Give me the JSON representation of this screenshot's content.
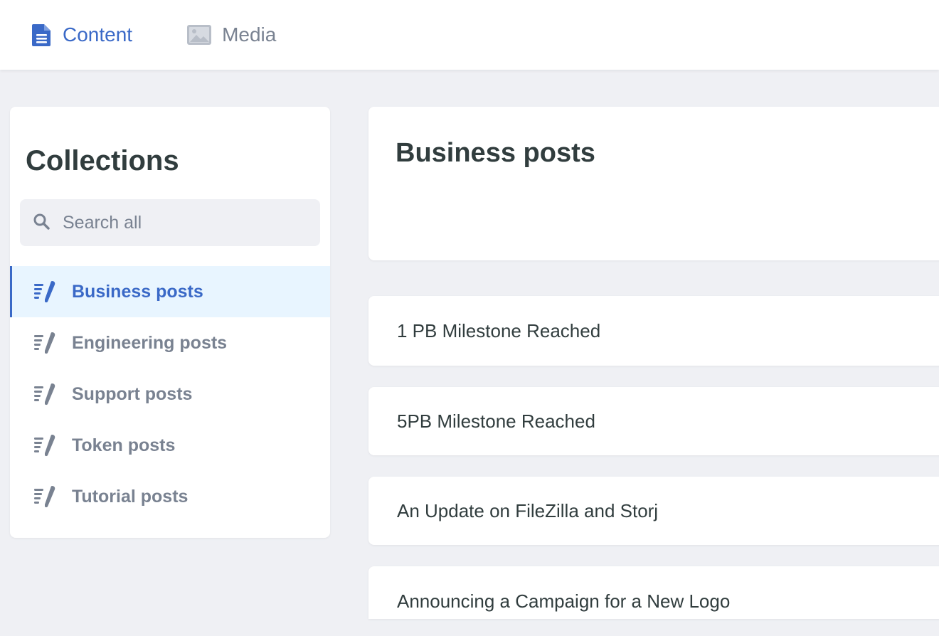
{
  "nav": {
    "tabs": [
      {
        "label": "Content",
        "icon": "document-icon",
        "active": true
      },
      {
        "label": "Media",
        "icon": "image-icon",
        "active": false
      }
    ]
  },
  "sidebar": {
    "title": "Collections",
    "search_placeholder": "Search all",
    "items": [
      {
        "label": "Business posts",
        "active": true
      },
      {
        "label": "Engineering posts",
        "active": false
      },
      {
        "label": "Support posts",
        "active": false
      },
      {
        "label": "Token posts",
        "active": false
      },
      {
        "label": "Tutorial posts",
        "active": false
      }
    ]
  },
  "main": {
    "title": "Business posts",
    "entries": [
      {
        "title": "1 PB Milestone Reached"
      },
      {
        "title": "5PB Milestone Reached"
      },
      {
        "title": "An Update on FileZilla and Storj"
      },
      {
        "title": "Announcing a Campaign for a New Logo"
      }
    ]
  },
  "colors": {
    "accent": "#3a69c7",
    "muted": "#798291",
    "text": "#313d3e",
    "background": "#eff0f4",
    "active_bg": "#e8f5ff"
  }
}
